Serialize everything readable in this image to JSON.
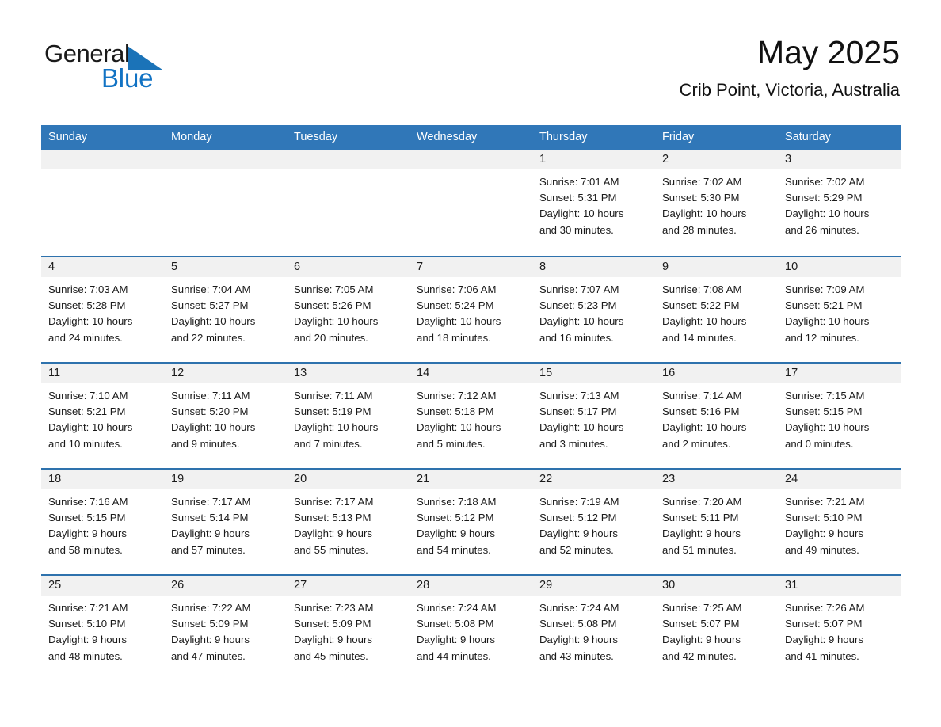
{
  "brand": {
    "name_part1": "General",
    "name_part2": "Blue",
    "accent_color": "#1273c4",
    "triangle_color": "#1b73b8"
  },
  "header": {
    "title": "May 2025",
    "subtitle": "Crib Point, Victoria, Australia"
  },
  "theme": {
    "header_blue": "#3077b8",
    "row_divider_blue": "#2e72ad",
    "daynum_band": "#f1f1f1"
  },
  "weekdays": [
    "Sunday",
    "Monday",
    "Tuesday",
    "Wednesday",
    "Thursday",
    "Friday",
    "Saturday"
  ],
  "weeks": [
    [
      {
        "day": "",
        "lines": []
      },
      {
        "day": "",
        "lines": []
      },
      {
        "day": "",
        "lines": []
      },
      {
        "day": "",
        "lines": []
      },
      {
        "day": "1",
        "lines": [
          "Sunrise: 7:01 AM",
          "Sunset: 5:31 PM",
          "Daylight: 10 hours",
          "and 30 minutes."
        ]
      },
      {
        "day": "2",
        "lines": [
          "Sunrise: 7:02 AM",
          "Sunset: 5:30 PM",
          "Daylight: 10 hours",
          "and 28 minutes."
        ]
      },
      {
        "day": "3",
        "lines": [
          "Sunrise: 7:02 AM",
          "Sunset: 5:29 PM",
          "Daylight: 10 hours",
          "and 26 minutes."
        ]
      }
    ],
    [
      {
        "day": "4",
        "lines": [
          "Sunrise: 7:03 AM",
          "Sunset: 5:28 PM",
          "Daylight: 10 hours",
          "and 24 minutes."
        ]
      },
      {
        "day": "5",
        "lines": [
          "Sunrise: 7:04 AM",
          "Sunset: 5:27 PM",
          "Daylight: 10 hours",
          "and 22 minutes."
        ]
      },
      {
        "day": "6",
        "lines": [
          "Sunrise: 7:05 AM",
          "Sunset: 5:26 PM",
          "Daylight: 10 hours",
          "and 20 minutes."
        ]
      },
      {
        "day": "7",
        "lines": [
          "Sunrise: 7:06 AM",
          "Sunset: 5:24 PM",
          "Daylight: 10 hours",
          "and 18 minutes."
        ]
      },
      {
        "day": "8",
        "lines": [
          "Sunrise: 7:07 AM",
          "Sunset: 5:23 PM",
          "Daylight: 10 hours",
          "and 16 minutes."
        ]
      },
      {
        "day": "9",
        "lines": [
          "Sunrise: 7:08 AM",
          "Sunset: 5:22 PM",
          "Daylight: 10 hours",
          "and 14 minutes."
        ]
      },
      {
        "day": "10",
        "lines": [
          "Sunrise: 7:09 AM",
          "Sunset: 5:21 PM",
          "Daylight: 10 hours",
          "and 12 minutes."
        ]
      }
    ],
    [
      {
        "day": "11",
        "lines": [
          "Sunrise: 7:10 AM",
          "Sunset: 5:21 PM",
          "Daylight: 10 hours",
          "and 10 minutes."
        ]
      },
      {
        "day": "12",
        "lines": [
          "Sunrise: 7:11 AM",
          "Sunset: 5:20 PM",
          "Daylight: 10 hours",
          "and 9 minutes."
        ]
      },
      {
        "day": "13",
        "lines": [
          "Sunrise: 7:11 AM",
          "Sunset: 5:19 PM",
          "Daylight: 10 hours",
          "and 7 minutes."
        ]
      },
      {
        "day": "14",
        "lines": [
          "Sunrise: 7:12 AM",
          "Sunset: 5:18 PM",
          "Daylight: 10 hours",
          "and 5 minutes."
        ]
      },
      {
        "day": "15",
        "lines": [
          "Sunrise: 7:13 AM",
          "Sunset: 5:17 PM",
          "Daylight: 10 hours",
          "and 3 minutes."
        ]
      },
      {
        "day": "16",
        "lines": [
          "Sunrise: 7:14 AM",
          "Sunset: 5:16 PM",
          "Daylight: 10 hours",
          "and 2 minutes."
        ]
      },
      {
        "day": "17",
        "lines": [
          "Sunrise: 7:15 AM",
          "Sunset: 5:15 PM",
          "Daylight: 10 hours",
          "and 0 minutes."
        ]
      }
    ],
    [
      {
        "day": "18",
        "lines": [
          "Sunrise: 7:16 AM",
          "Sunset: 5:15 PM",
          "Daylight: 9 hours",
          "and 58 minutes."
        ]
      },
      {
        "day": "19",
        "lines": [
          "Sunrise: 7:17 AM",
          "Sunset: 5:14 PM",
          "Daylight: 9 hours",
          "and 57 minutes."
        ]
      },
      {
        "day": "20",
        "lines": [
          "Sunrise: 7:17 AM",
          "Sunset: 5:13 PM",
          "Daylight: 9 hours",
          "and 55 minutes."
        ]
      },
      {
        "day": "21",
        "lines": [
          "Sunrise: 7:18 AM",
          "Sunset: 5:12 PM",
          "Daylight: 9 hours",
          "and 54 minutes."
        ]
      },
      {
        "day": "22",
        "lines": [
          "Sunrise: 7:19 AM",
          "Sunset: 5:12 PM",
          "Daylight: 9 hours",
          "and 52 minutes."
        ]
      },
      {
        "day": "23",
        "lines": [
          "Sunrise: 7:20 AM",
          "Sunset: 5:11 PM",
          "Daylight: 9 hours",
          "and 51 minutes."
        ]
      },
      {
        "day": "24",
        "lines": [
          "Sunrise: 7:21 AM",
          "Sunset: 5:10 PM",
          "Daylight: 9 hours",
          "and 49 minutes."
        ]
      }
    ],
    [
      {
        "day": "25",
        "lines": [
          "Sunrise: 7:21 AM",
          "Sunset: 5:10 PM",
          "Daylight: 9 hours",
          "and 48 minutes."
        ]
      },
      {
        "day": "26",
        "lines": [
          "Sunrise: 7:22 AM",
          "Sunset: 5:09 PM",
          "Daylight: 9 hours",
          "and 47 minutes."
        ]
      },
      {
        "day": "27",
        "lines": [
          "Sunrise: 7:23 AM",
          "Sunset: 5:09 PM",
          "Daylight: 9 hours",
          "and 45 minutes."
        ]
      },
      {
        "day": "28",
        "lines": [
          "Sunrise: 7:24 AM",
          "Sunset: 5:08 PM",
          "Daylight: 9 hours",
          "and 44 minutes."
        ]
      },
      {
        "day": "29",
        "lines": [
          "Sunrise: 7:24 AM",
          "Sunset: 5:08 PM",
          "Daylight: 9 hours",
          "and 43 minutes."
        ]
      },
      {
        "day": "30",
        "lines": [
          "Sunrise: 7:25 AM",
          "Sunset: 5:07 PM",
          "Daylight: 9 hours",
          "and 42 minutes."
        ]
      },
      {
        "day": "31",
        "lines": [
          "Sunrise: 7:26 AM",
          "Sunset: 5:07 PM",
          "Daylight: 9 hours",
          "and 41 minutes."
        ]
      }
    ]
  ]
}
